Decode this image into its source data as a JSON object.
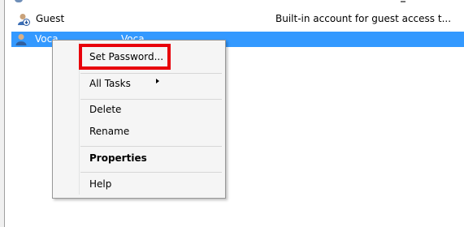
{
  "users": [
    {
      "name": "Guest",
      "full_name": "",
      "description": "Built-in account for guest access t...",
      "selected": false,
      "icon": "disabled-user-icon"
    },
    {
      "name": "Voca",
      "full_name": "Voca",
      "description": "",
      "selected": true,
      "icon": "user-icon"
    }
  ],
  "context_menu": {
    "items": [
      {
        "label": "Set Password...",
        "highlighted_by_annotation": true
      },
      {
        "label": "All Tasks",
        "has_submenu": true
      },
      {
        "label": "Delete"
      },
      {
        "label": "Rename"
      },
      {
        "label": "Properties",
        "bold": true
      },
      {
        "label": "Help"
      }
    ]
  },
  "colors": {
    "selection": "#3399ff",
    "annotation_box": "#e8000b",
    "menu_background": "#f5f5f5"
  }
}
